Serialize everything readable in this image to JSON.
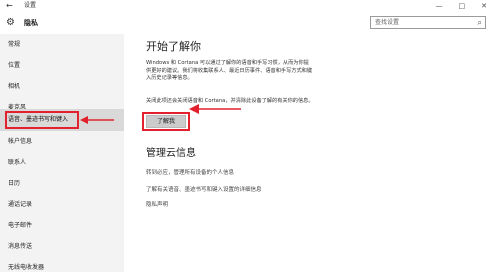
{
  "window": {
    "back_symbol": "←",
    "title": "设置",
    "controls": [
      "—",
      "□",
      "✕"
    ]
  },
  "header": {
    "icon": "gear-icon",
    "title": "隐私",
    "search_placeholder": "查找设置",
    "search_icon": "search-icon"
  },
  "sidebar": {
    "items": [
      {
        "label": "常规"
      },
      {
        "label": "位置"
      },
      {
        "label": "相机"
      },
      {
        "label": "麦克风"
      },
      {
        "label": "语音、墨迹书写和键入",
        "active": true
      },
      {
        "label": "帐户信息"
      },
      {
        "label": "联系人"
      },
      {
        "label": "日历"
      },
      {
        "label": "通话记录"
      },
      {
        "label": "电子邮件"
      },
      {
        "label": "消息传送"
      },
      {
        "label": "无线电收发器"
      }
    ]
  },
  "main": {
    "section1_title": "开始了解你",
    "section1_para1": "Windows 和 Cortana 可以通过了解你的语音和手写习惯，从而为你提供更好的建议。我们将收集联系人、最近日历事件、语音和手写方式和键入历史记录等信息。",
    "section1_para2": "关闭此项还会关闭语音和 Cortana，并清除此设备了解的有关你的信息。",
    "button_label": "了解我",
    "section2_title": "管理云信息",
    "links": [
      "转到必应，管理所有设备的个人信息",
      "了解有关语音、墨迹书写和键入设置的详细信息",
      "隐私声明"
    ]
  },
  "colors": {
    "highlight": "#e3202e",
    "sidebar_bg": "#f3f3f3",
    "active_item_bg": "#d9d9d9",
    "button_bg": "#cccccc"
  }
}
